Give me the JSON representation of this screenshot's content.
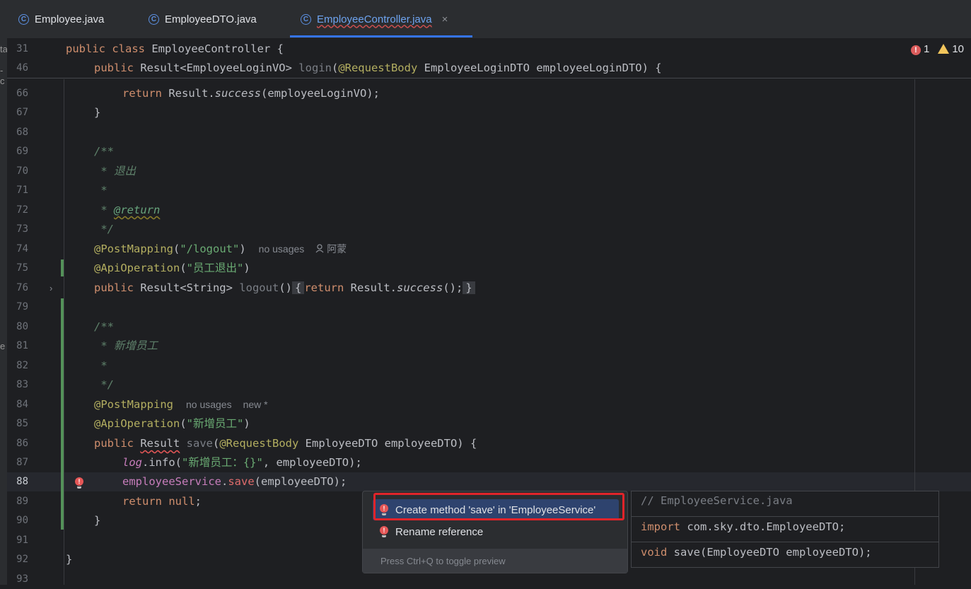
{
  "tabs": [
    {
      "label": "Employee.java",
      "icon": "class-icon"
    },
    {
      "label": "EmployeeDTO.java",
      "icon": "class-icon"
    },
    {
      "label": "EmployeeController.java",
      "icon": "class-icon",
      "active": true,
      "close": "×"
    }
  ],
  "inspections": {
    "errors": "1",
    "warnings": "10"
  },
  "left_strip": [
    "ta",
    "-c",
    "e"
  ],
  "sticky": [
    {
      "line": "31",
      "t": {
        "kw": "public class ",
        "name": "EmployeeController",
        "rest": " {"
      }
    },
    {
      "line": "46",
      "t": {
        "kw": "public ",
        "type": "Result<EmployeeLoginVO> ",
        "meth": "login",
        "p1": "(",
        "ann": "@RequestBody",
        "rest": " EmployeeLoginDTO employeeLoginDTO) {"
      }
    }
  ],
  "lines": {
    "l66": {
      "n": "66",
      "kw": "return ",
      "a": "Result.",
      "b": "success",
      "c": "(employeeLoginVO);"
    },
    "l67": {
      "n": "67",
      "a": "}"
    },
    "l68": {
      "n": "68"
    },
    "l69": {
      "n": "69",
      "a": "/**"
    },
    "l70": {
      "n": "70",
      "a": " * 退出"
    },
    "l71": {
      "n": "71",
      "a": " *"
    },
    "l72": {
      "n": "72",
      "a": " * ",
      "tag": "@return"
    },
    "l73": {
      "n": "73",
      "a": " */"
    },
    "l74": {
      "n": "74",
      "ann": "@PostMapping",
      "p": "(",
      "str": "\"/logout\"",
      "q": ")",
      "hint1": "no usages",
      "author": "阿蒙"
    },
    "l75": {
      "n": "75",
      "ann": "@ApiOperation",
      "p": "(",
      "str": "\"员工退出\"",
      "q": ")"
    },
    "l76": {
      "n": "76",
      "kw": "public ",
      "type": "Result<String> ",
      "meth": "logout",
      "p": "()",
      "f1": "{",
      "kw2": "return ",
      "a": "Result.",
      "b": "success",
      "c": "();",
      "f2": "}"
    },
    "l79": {
      "n": "79"
    },
    "l80": {
      "n": "80",
      "a": "/**"
    },
    "l81": {
      "n": "81",
      "a": " * 新增员工"
    },
    "l82": {
      "n": "82",
      "a": " *"
    },
    "l83": {
      "n": "83",
      "a": " */"
    },
    "l84": {
      "n": "84",
      "ann": "@PostMapping",
      "hint1": "no usages",
      "hint2": "new *"
    },
    "l85": {
      "n": "85",
      "ann": "@ApiOperation",
      "p": "(",
      "str": "\"新增员工\"",
      "q": ")"
    },
    "l86": {
      "n": "86",
      "kw": "public ",
      "err": "Result",
      "sp": " ",
      "meth": "save",
      "p": "(",
      "ann": "@RequestBody",
      "rest": " EmployeeDTO employeeDTO) {"
    },
    "l87": {
      "n": "87",
      "field": "log",
      "a": ".info(",
      "str": "\"新增员工：{}\"",
      "c": ", employeeDTO);"
    },
    "l88": {
      "n": "88",
      "field": "employeeService",
      "a": ".",
      "meth": "save",
      "c": "(employeeDTO);"
    },
    "l89": {
      "n": "89",
      "kw": "return null",
      "c": ";"
    },
    "l90": {
      "n": "90",
      "a": "}"
    },
    "l91": {
      "n": "91"
    },
    "l92": {
      "n": "92",
      "a": "}"
    },
    "l93": {
      "n": "93"
    }
  },
  "popup": {
    "items": [
      {
        "label": "Create method 'save' in 'EmployeeService'",
        "icon": "error-bulb-icon"
      },
      {
        "label": "Rename reference",
        "icon": "error-bulb-icon"
      }
    ],
    "footer": "Press Ctrl+Q to toggle preview"
  },
  "preview": {
    "comment": "// EmployeeService.java",
    "import_kw": "import",
    "import_rest": " com.sky.dto.EmployeeDTO;",
    "void_kw": "void",
    "void_rest": " save(EmployeeDTO employeeDTO);"
  },
  "colors": {
    "accent": "#3574f0",
    "error": "#db5c5c",
    "warning": "#f2c55c",
    "highlight_box": "#e0242a"
  }
}
